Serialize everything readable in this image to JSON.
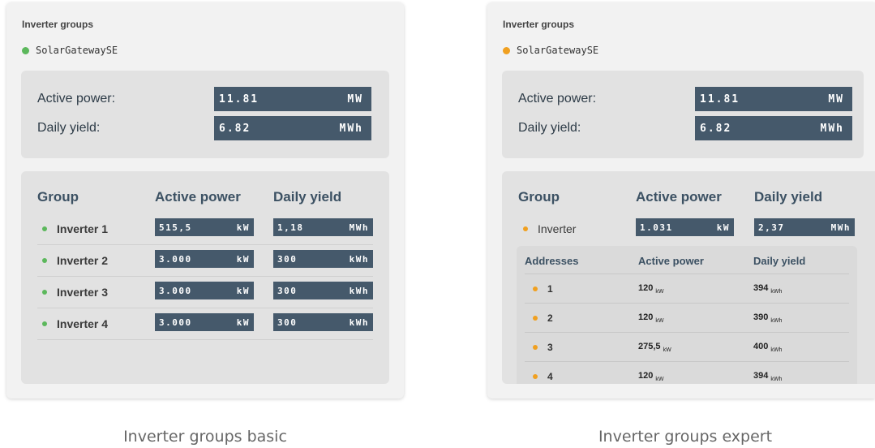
{
  "colors": {
    "green": "#5cb85c",
    "orange": "#f0a020",
    "box": "#45596b"
  },
  "basic": {
    "title": "Inverter groups",
    "gateway": "SolarGatewaySE",
    "summary": {
      "active_label": "Active power:",
      "active_value": "11.81",
      "active_unit": "MW",
      "yield_label": "Daily yield:",
      "yield_value": "6.82",
      "yield_unit": "MWh"
    },
    "headers": {
      "group": "Group",
      "active": "Active power",
      "yield": "Daily yield"
    },
    "rows": [
      {
        "name": "Inverter 1",
        "power": "515,5",
        "power_unit": "kW",
        "yield": "1,18",
        "yield_unit": "MWh"
      },
      {
        "name": "Inverter 2",
        "power": "3.000",
        "power_unit": "kW",
        "yield": "300",
        "yield_unit": "kWh"
      },
      {
        "name": "Inverter 3",
        "power": "3.000",
        "power_unit": "kW",
        "yield": "300",
        "yield_unit": "kWh"
      },
      {
        "name": "Inverter 4",
        "power": "3.000",
        "power_unit": "kW",
        "yield": "300",
        "yield_unit": "kWh"
      }
    ],
    "caption": "Inverter groups basic"
  },
  "expert": {
    "title": "Inverter groups",
    "gateway": "SolarGatewaySE",
    "summary": {
      "active_label": "Active power:",
      "active_value": "11.81",
      "active_unit": "MW",
      "yield_label": "Daily yield:",
      "yield_value": "6.82",
      "yield_unit": "MWh"
    },
    "headers": {
      "group": "Group",
      "active": "Active power",
      "yield": "Daily yield"
    },
    "inverter": {
      "name": "Inverter",
      "power": "1.031",
      "power_unit": "kW",
      "yield": "2,37",
      "yield_unit": "MWh"
    },
    "addr_headers": {
      "addresses": "Addresses",
      "active": "Active power",
      "yield": "Daily yield"
    },
    "addresses": [
      {
        "id": "1",
        "power": "120",
        "power_unit": "kW",
        "yield": "394",
        "yield_unit": "kWh"
      },
      {
        "id": "2",
        "power": "120",
        "power_unit": "kW",
        "yield": "390",
        "yield_unit": "kWh"
      },
      {
        "id": "3",
        "power": "275,5",
        "power_unit": "kW",
        "yield": "400",
        "yield_unit": "kWh"
      },
      {
        "id": "4",
        "power": "120",
        "power_unit": "kW",
        "yield": "394",
        "yield_unit": "kWh"
      }
    ],
    "caption": "Inverter groups expert"
  }
}
